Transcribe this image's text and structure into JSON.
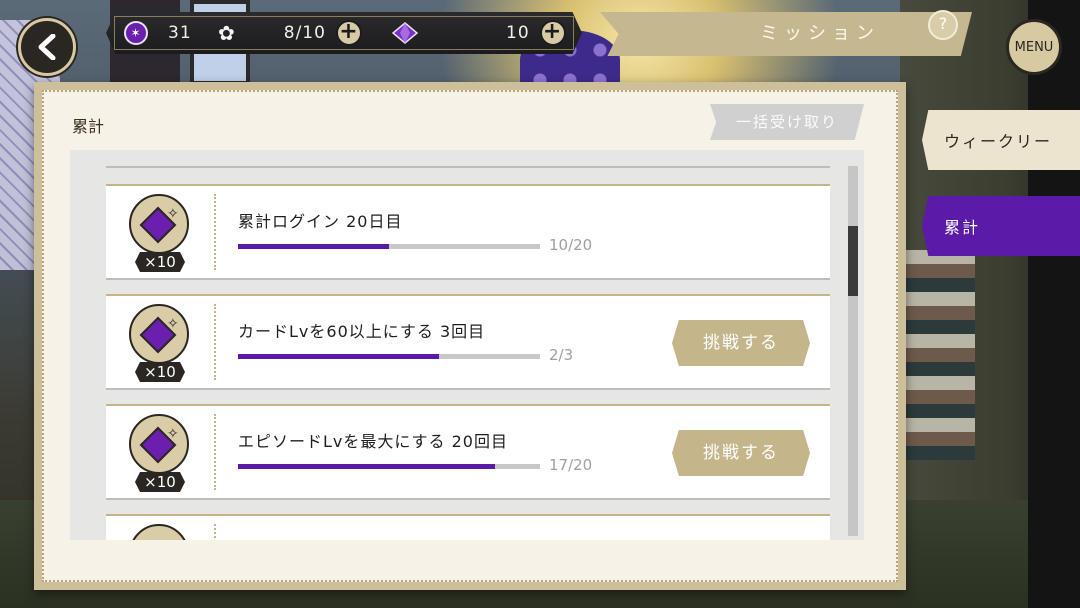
{
  "header": {
    "resources": {
      "gem_coin_count": "31",
      "stamina": "8/10",
      "crystal_count": "10"
    },
    "title": "ミッション",
    "help_label": "?",
    "menu_label": "MENU"
  },
  "tabs": [
    {
      "label": "ウィークリー",
      "selected": false
    },
    {
      "label": "累計",
      "selected": true
    }
  ],
  "panel": {
    "title": "累計",
    "collect_all_label": "一括受け取り"
  },
  "missions": [
    {
      "title": "累計ログイン 20日目",
      "progress": "10/20",
      "fraction": 0.5,
      "reward": "×10",
      "button": ""
    },
    {
      "title": "カードLvを60以上にする 3回目",
      "progress": "2/3",
      "fraction": 0.667,
      "reward": "×10",
      "button": "挑戦する"
    },
    {
      "title": "エピソードLvを最大にする 20回目",
      "progress": "17/20",
      "fraction": 0.85,
      "reward": "×10",
      "button": "挑戦する"
    }
  ],
  "colors": {
    "accent_purple": "#5b1aa7",
    "panel_gold": "#cdbf9a",
    "button_gold": "#c5b58b"
  }
}
